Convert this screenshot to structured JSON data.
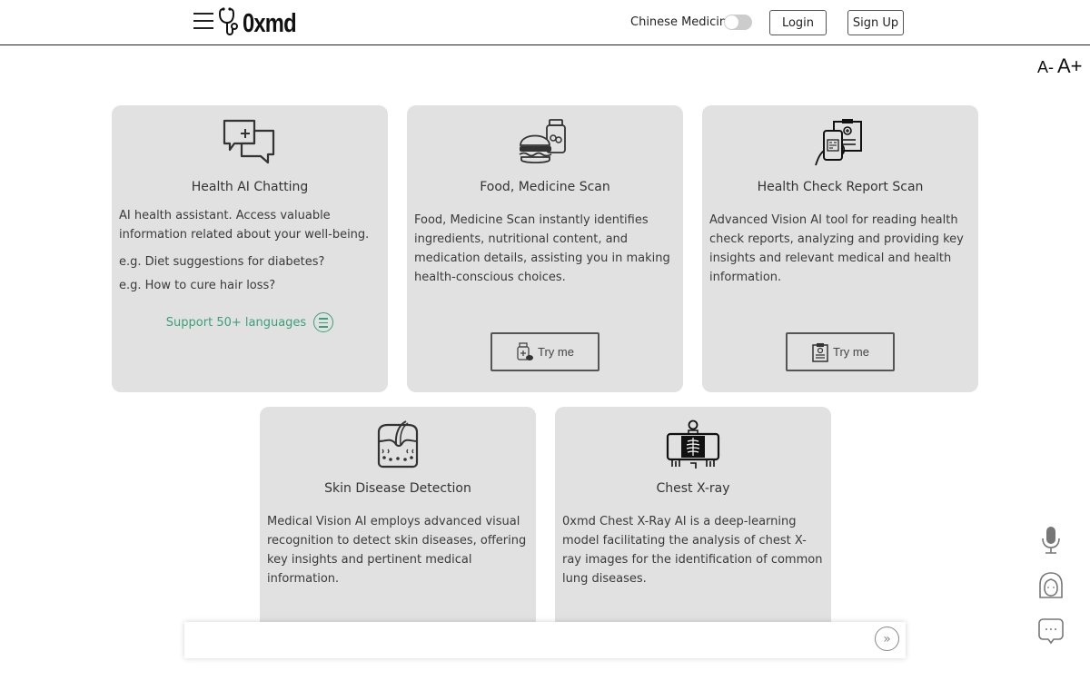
{
  "header": {
    "logo_text": "0xmd",
    "chinese_medicine_label": "Chinese Medicine",
    "chinese_medicine_enabled": false,
    "login_label": "Login",
    "signup_label": "Sign Up"
  },
  "font_controls": {
    "decrease_label": "A-",
    "increase_label": "A+"
  },
  "cards": [
    {
      "title": "Health AI Chatting",
      "icon": "chat-bubbles-icon",
      "description": "AI health assistant. Access valuable information related about your well-being.",
      "examples": [
        "e.g. Diet suggestions for diabetes?",
        "e.g. How to cure hair loss?"
      ],
      "support_text": "Support 50+ languages"
    },
    {
      "title": "Food, Medicine Scan",
      "icon": "burger-medicine-icon",
      "description": "Food, Medicine Scan instantly identifies ingredients, nutritional content, and medication details, assisting you in making health-conscious choices.",
      "button_label": "Try me"
    },
    {
      "title": "Health Check Report Scan",
      "icon": "phone-report-icon",
      "description": "Advanced Vision AI tool for reading health check reports, analyzing and providing key insights and relevant medical and health information.",
      "button_label": "Try me"
    },
    {
      "title": "Skin Disease Detection",
      "icon": "skin-layer-icon",
      "description": "Medical Vision AI employs advanced visual recognition to detect skin diseases, offering key insights and pertinent medical information."
    },
    {
      "title": "Chest X-ray",
      "icon": "chest-xray-icon",
      "description": "0xmd Chest X-Ray AI is a deep-learning model facilitating the analysis of chest X-ray images for the identification of common lung diseases."
    }
  ],
  "side_icons": [
    "microphone-icon",
    "avatar-icon",
    "chat-icon"
  ],
  "chat_bar": {
    "placeholder": "",
    "send_icon": "double-chevron-right-icon"
  },
  "colors": {
    "card_bg": "#e1e1e1",
    "accent_green": "#3aa07a",
    "text": "#333333"
  }
}
